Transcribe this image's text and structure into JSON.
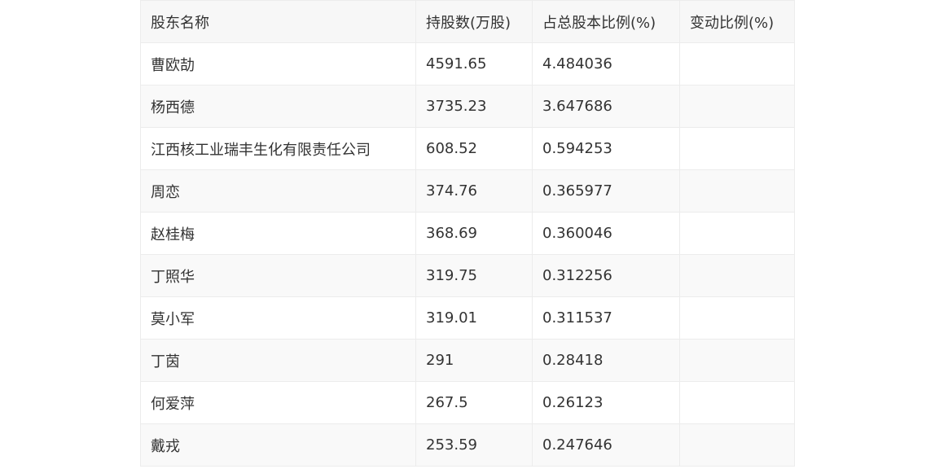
{
  "table": {
    "headers": [
      "股东名称",
      "持股数(万股)",
      "占总股本比例(%)",
      "变动比例(%)"
    ],
    "rows": [
      [
        "曹欧劼",
        "4591.65",
        "4.484036",
        ""
      ],
      [
        "杨西德",
        "3735.23",
        "3.647686",
        ""
      ],
      [
        "江西核工业瑞丰生化有限责任公司",
        "608.52",
        "0.594253",
        ""
      ],
      [
        "周恋",
        "374.76",
        "0.365977",
        ""
      ],
      [
        "赵桂梅",
        "368.69",
        "0.360046",
        ""
      ],
      [
        "丁照华",
        "319.75",
        "0.312256",
        ""
      ],
      [
        "莫小军",
        "319.01",
        "0.311537",
        ""
      ],
      [
        "丁茵",
        "291",
        "0.28418",
        ""
      ],
      [
        "何爱萍",
        "267.5",
        "0.26123",
        ""
      ],
      [
        "戴戎",
        "253.59",
        "0.247646",
        ""
      ]
    ]
  }
}
